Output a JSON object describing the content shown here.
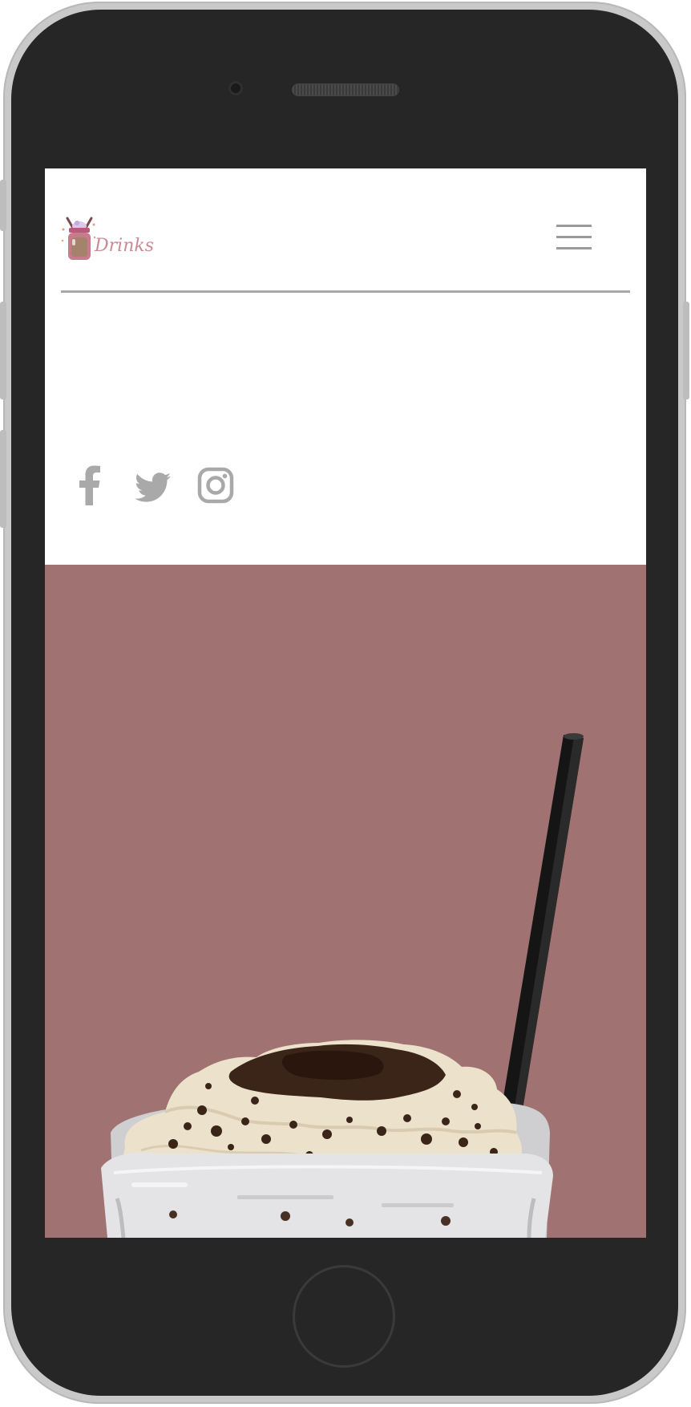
{
  "device": {
    "frame_color": "#262626",
    "bezel_color": "#c9c9c9"
  },
  "header": {
    "logo_text": "Drinks",
    "logo_icon": "milkshake-jar-icon",
    "menu_icon": "hamburger-menu-icon"
  },
  "social": {
    "items": [
      {
        "name": "facebook",
        "icon": "facebook-icon"
      },
      {
        "name": "twitter",
        "icon": "twitter-icon"
      },
      {
        "name": "instagram",
        "icon": "instagram-icon"
      }
    ],
    "icon_color": "#a9a9a9"
  },
  "hero": {
    "background_color": "#a07272",
    "image": "milkshake-with-whipped-cream-and-straw"
  }
}
